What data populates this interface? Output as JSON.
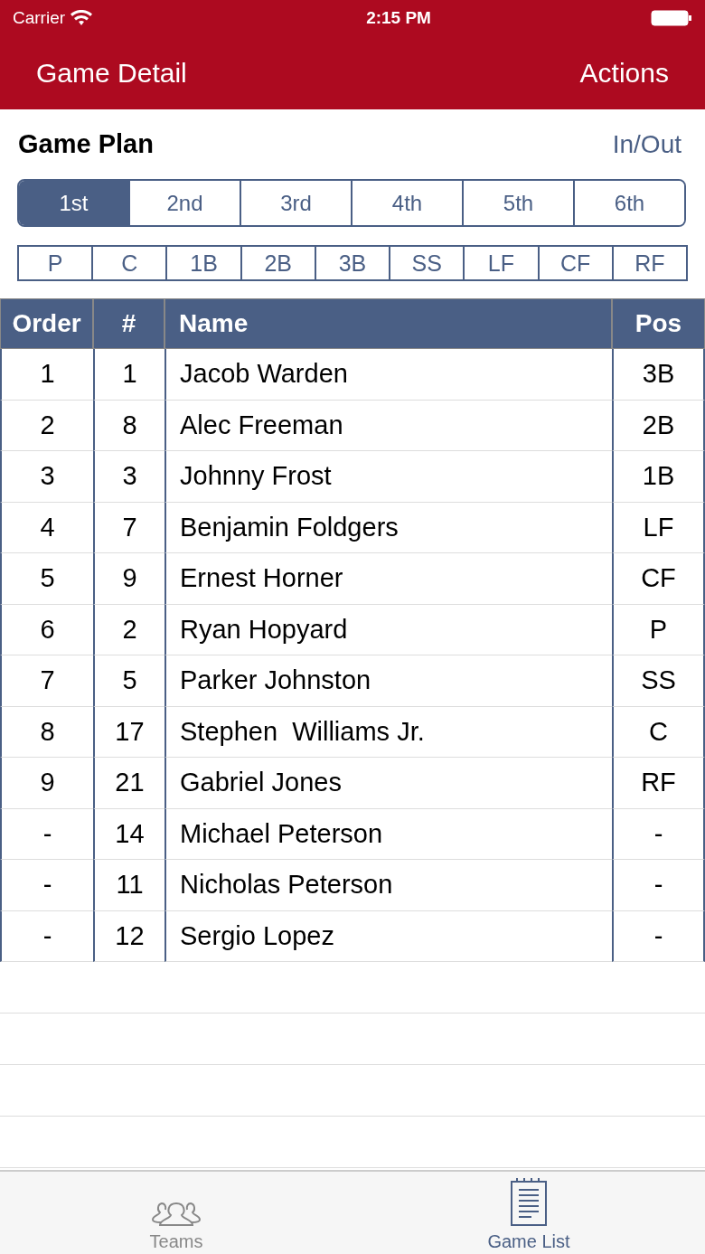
{
  "status_bar": {
    "carrier": "Carrier",
    "time": "2:15 PM"
  },
  "nav": {
    "title": "Game Detail",
    "action": "Actions"
  },
  "section": {
    "title": "Game Plan",
    "action": "In/Out"
  },
  "innings": [
    {
      "label": "1st",
      "selected": true
    },
    {
      "label": "2nd",
      "selected": false
    },
    {
      "label": "3rd",
      "selected": false
    },
    {
      "label": "4th",
      "selected": false
    },
    {
      "label": "5th",
      "selected": false
    },
    {
      "label": "6th",
      "selected": false
    }
  ],
  "positions": [
    "P",
    "C",
    "1B",
    "2B",
    "3B",
    "SS",
    "LF",
    "CF",
    "RF"
  ],
  "table": {
    "columns": [
      "Order",
      "#",
      "Name",
      "Pos"
    ],
    "rows": [
      [
        "1",
        "1",
        "Jacob Warden",
        "3B"
      ],
      [
        "2",
        "8",
        "Alec Freeman",
        "2B"
      ],
      [
        "3",
        "3",
        "Johnny Frost",
        "1B"
      ],
      [
        "4",
        "7",
        "Benjamin Foldgers",
        "LF"
      ],
      [
        "5",
        "9",
        "Ernest Horner",
        "CF"
      ],
      [
        "6",
        "2",
        "Ryan Hopyard",
        "P"
      ],
      [
        "7",
        "5",
        "Parker Johnston",
        "SS"
      ],
      [
        "8",
        "17",
        "Stephen  Williams Jr.",
        "C"
      ],
      [
        "9",
        "21",
        "Gabriel Jones",
        "RF"
      ],
      [
        "-",
        "14",
        "Michael Peterson",
        "-"
      ],
      [
        "-",
        "11",
        "Nicholas Peterson",
        "-"
      ],
      [
        "-",
        "12",
        "Sergio Lopez",
        "-"
      ]
    ]
  },
  "tab_bar": [
    {
      "label": "Teams",
      "kind": "teams",
      "selected": false
    },
    {
      "label": "Game List",
      "kind": "list",
      "selected": true
    }
  ]
}
